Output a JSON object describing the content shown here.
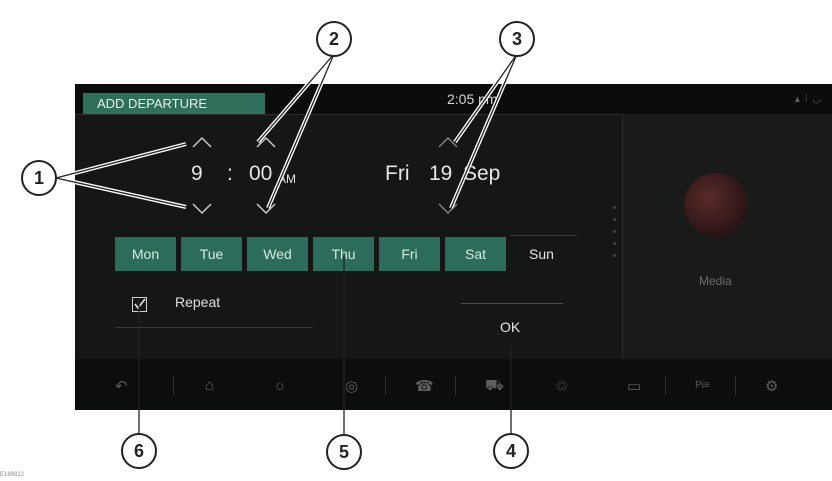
{
  "header": {
    "title": "ADD DEPARTURE",
    "time": "2:05 pm"
  },
  "time_picker": {
    "hour": "9",
    "separator": ":",
    "minute": "00",
    "ampm": "AM"
  },
  "date": {
    "weekday": "Fri",
    "day": "19",
    "month": "Sep"
  },
  "days": [
    {
      "label": "Mon",
      "selected": true
    },
    {
      "label": "Tue",
      "selected": true
    },
    {
      "label": "Wed",
      "selected": true
    },
    {
      "label": "Thu",
      "selected": true
    },
    {
      "label": "Fri",
      "selected": true
    },
    {
      "label": "Sat",
      "selected": true
    },
    {
      "label": "Sun",
      "selected": false
    }
  ],
  "repeat": {
    "label": "Repeat",
    "checked": true
  },
  "ok_label": "OK",
  "media": {
    "label": "Media"
  },
  "callouts": [
    "1",
    "2",
    "3",
    "4",
    "5",
    "6"
  ],
  "figure_id": "E189812",
  "colors": {
    "accent": "#2f6f5c",
    "screen_bg": "#141716"
  }
}
